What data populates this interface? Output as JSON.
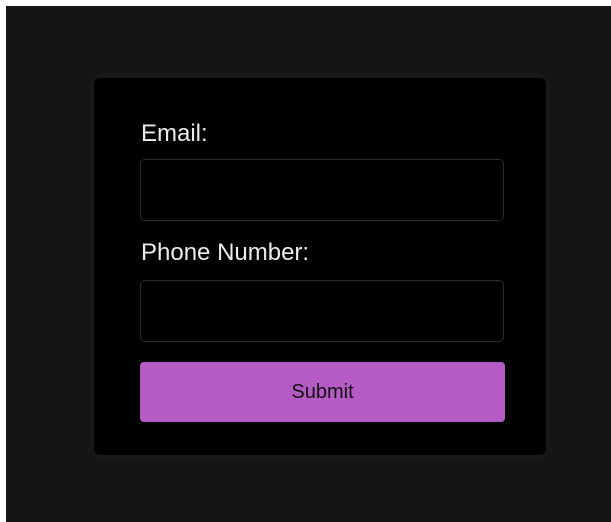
{
  "form": {
    "email_label": "Email:",
    "email_value": "",
    "email_placeholder": "",
    "phone_label": "Phone Number:",
    "phone_value": "",
    "phone_placeholder": "",
    "submit_label": "Submit"
  },
  "colors": {
    "page_background": "#151515",
    "card_background": "#010101",
    "accent": "#b55bc5",
    "label_text": "#ececec"
  }
}
